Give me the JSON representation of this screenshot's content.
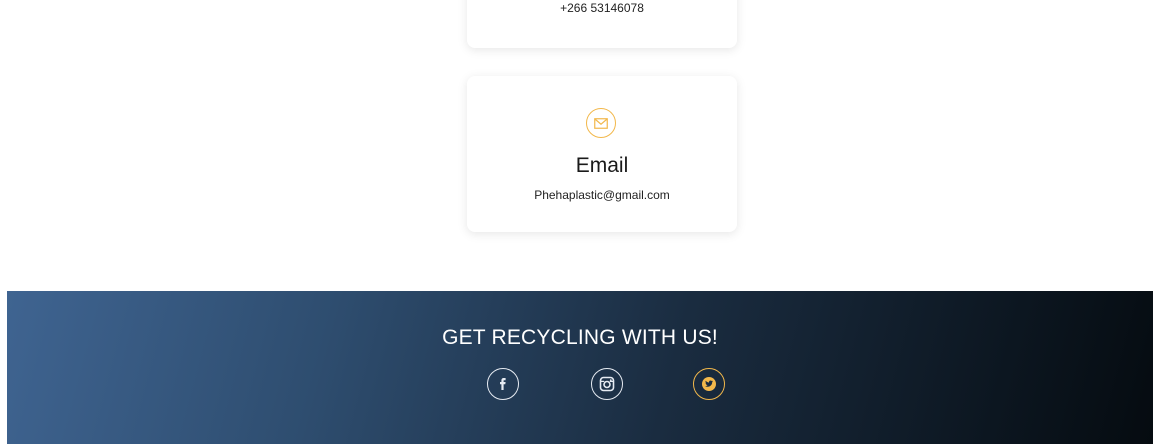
{
  "contact": {
    "phone": {
      "value": "+266 53146078"
    },
    "email": {
      "icon": "envelope-icon",
      "title": "Email",
      "value": "Phehaplastic@gmail.com"
    }
  },
  "footer": {
    "title": "GET RECYCLING WITH US!",
    "social": [
      {
        "name": "facebook",
        "icon": "facebook-icon"
      },
      {
        "name": "instagram",
        "icon": "instagram-icon"
      },
      {
        "name": "twitter",
        "icon": "twitter-icon"
      }
    ]
  },
  "colors": {
    "accent": "#f2b84b",
    "footer_gradient_start": "#3f6491",
    "footer_gradient_end": "#050b10",
    "text_dark": "#1a1a1a"
  }
}
